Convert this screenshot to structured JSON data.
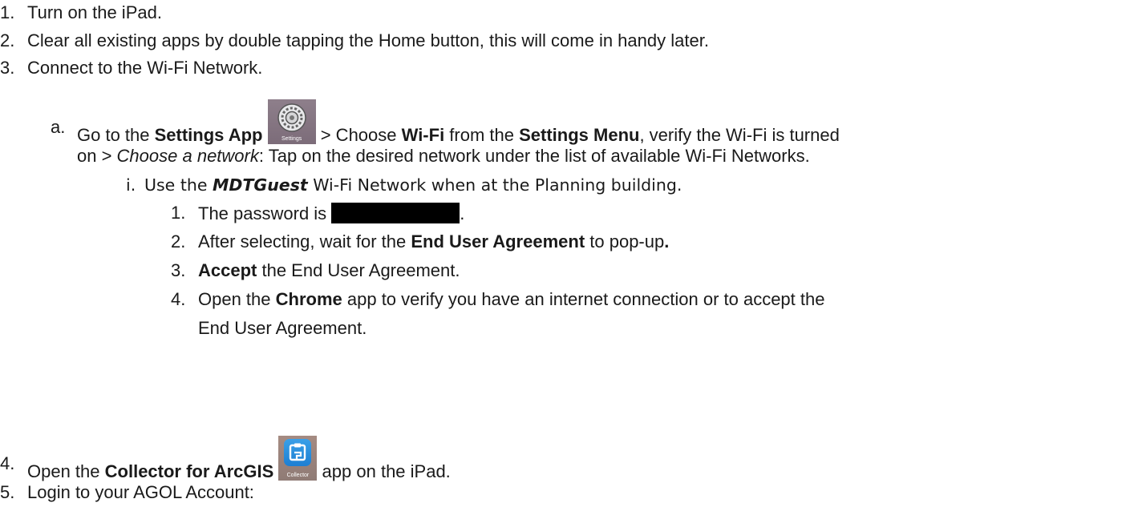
{
  "items": {
    "l1": {
      "num": "1.",
      "text": "Turn on the iPad."
    },
    "l2": {
      "num": "2.",
      "text": "Clear all existing apps by double tapping the Home button, this will come in handy later."
    },
    "l3": {
      "num": "3.",
      "text": "Connect to the Wi-Fi Network."
    },
    "a": {
      "num": "a.",
      "go_to": "Go to the ",
      "settings_app": "Settings App",
      "settings_icon_label": "Settings",
      "choose": " > Choose ",
      "wifi": "Wi-Fi",
      "from_the": "  from the ",
      "settings_menu": "Settings Menu",
      "verify": ", verify the Wi-Fi is turned",
      "on": "on > ",
      "choose_network": "Choose a network",
      "tap": ": Tap on the desired network under the list of available Wi-Fi Networks."
    },
    "i": {
      "num": "i.",
      "use_the": "Use the ",
      "network": "MDTGuest",
      "rest": " Wi-Fi Network when at the Planning building."
    },
    "s1": {
      "num": "1.",
      "text": "The password is ",
      "end": "."
    },
    "s2": {
      "num": "2.",
      "pre": "After selecting, wait for the ",
      "bold": "End User Agreement",
      "post": " to pop-up",
      "dot": "."
    },
    "s3": {
      "num": "3.",
      "bold": "Accept",
      "post": " the End User Agreement."
    },
    "s4": {
      "num": "4.",
      "pre": "Open the ",
      "bold": "Chrome",
      "post": " app to verify you have an internet connection or to accept the",
      "line2": "End User Agreement."
    },
    "l4": {
      "num": "4.",
      "pre": "Open the ",
      "bold": "Collector for ArcGIS",
      "icon_label": "Collector",
      "post": " app on the iPad."
    },
    "l5": {
      "num": "5.",
      "text": "Login to your AGOL Account:"
    }
  }
}
